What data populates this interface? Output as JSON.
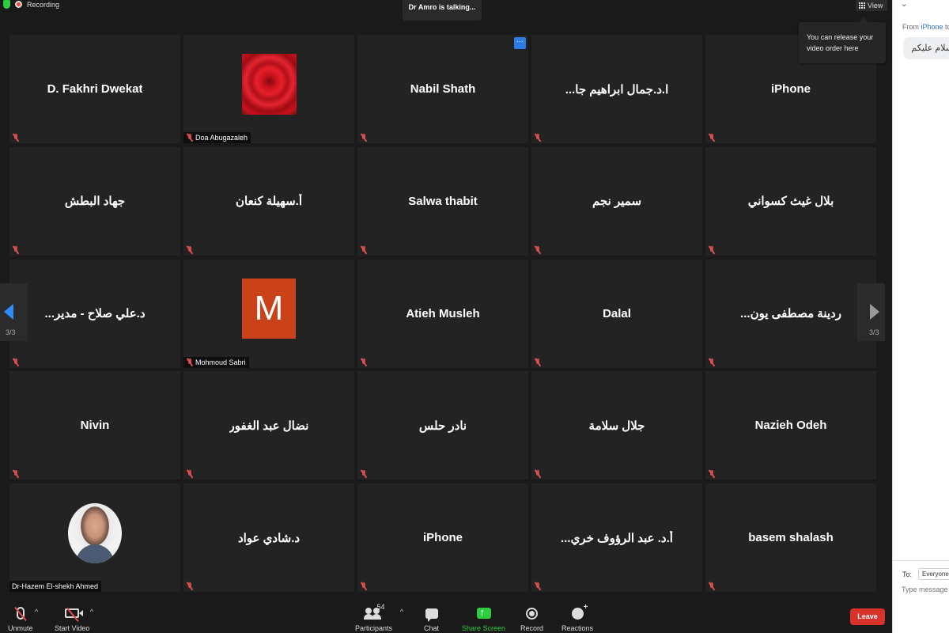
{
  "topbar": {
    "recording_label": "Recording",
    "talking": "Dr Amro is talking...",
    "view_label": "View"
  },
  "tooltip": "You can release your video order here",
  "tiles": [
    {
      "name": "D. Fakhri Dwekat",
      "kind": "name"
    },
    {
      "name": "Doa Abugazaleh",
      "kind": "image",
      "image": "rose"
    },
    {
      "name": "Nabil Shath",
      "kind": "name"
    },
    {
      "name": "...ا.د.جمال ابراهيم جا",
      "kind": "name"
    },
    {
      "name": "iPhone",
      "kind": "name"
    },
    {
      "name": "جهاد البطش",
      "kind": "name"
    },
    {
      "name": "أ.سهيلة كنعان",
      "kind": "name"
    },
    {
      "name": "Salwa thabit",
      "kind": "name"
    },
    {
      "name": "سمير نجم",
      "kind": "name"
    },
    {
      "name": "بلال غيث كسواني",
      "kind": "name"
    },
    {
      "name": "...د.علي صلاح - مدير",
      "kind": "name"
    },
    {
      "name": "Mohmoud Sabri",
      "kind": "image",
      "image": "avatar-m",
      "initial": "M"
    },
    {
      "name": "Atieh Musleh",
      "kind": "name"
    },
    {
      "name": "Dalal",
      "kind": "name"
    },
    {
      "name": "...ردينة مصطفى يون",
      "kind": "name"
    },
    {
      "name": "Nivin",
      "kind": "name"
    },
    {
      "name": "نضال عبد الغفور",
      "kind": "name"
    },
    {
      "name": "نادر حلس",
      "kind": "name"
    },
    {
      "name": "جلال سلامة",
      "kind": "name"
    },
    {
      "name": "Nazieh Odeh",
      "kind": "name"
    },
    {
      "name": "Dr-Hazem El-shekh Ahmed",
      "kind": "image",
      "image": "photo",
      "no_mic": true
    },
    {
      "name": "د.شادي عواد",
      "kind": "name"
    },
    {
      "name": "iPhone",
      "kind": "name"
    },
    {
      "name": "...أ.د. عبد الرؤوف خري",
      "kind": "name"
    },
    {
      "name": "basem shalash",
      "kind": "name"
    }
  ],
  "pager": {
    "left": "3/3",
    "right": "3/3"
  },
  "toolbar": {
    "unmute": "Unmute",
    "start_video": "Start Video",
    "participants": "Participants",
    "participant_count": "54",
    "chat": "Chat",
    "share_screen": "Share Screen",
    "record": "Record",
    "reactions": "Reactions",
    "leave": "Leave"
  },
  "chat": {
    "from_prefix": "From ",
    "from_name": "iPhone",
    "from_suffix": " to",
    "message": "السلام عليكم",
    "to_label": "To:",
    "to_value": "Everyone",
    "input_placeholder": "Type message"
  },
  "colors": {
    "accent_blue": "#2d8cff",
    "share_green": "#2ecc40",
    "leave_red": "#d9322a",
    "avatar_m": "#c9421a"
  }
}
